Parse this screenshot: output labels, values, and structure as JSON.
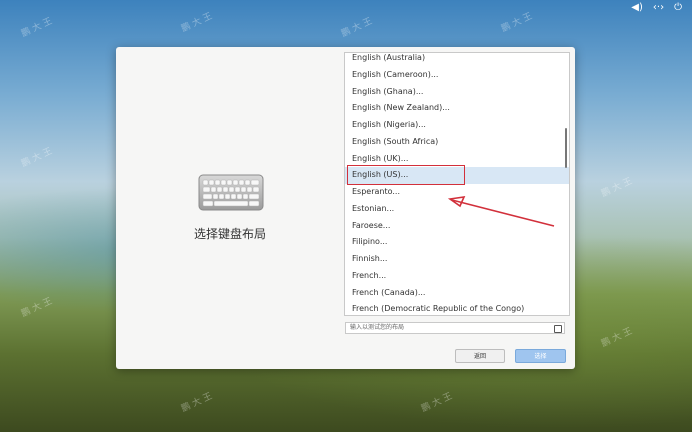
{
  "topbar": {
    "volume_icon": "speaker-icon",
    "network_icon": "network-icon",
    "power_icon": "power-icon"
  },
  "dialog": {
    "title": "选择键盘布局",
    "layouts": [
      "English (Australia)",
      "English (Cameroon)...",
      "English (Ghana)...",
      "English (New Zealand)...",
      "English (Nigeria)...",
      "English (South Africa)",
      "English (UK)...",
      "English (US)...",
      "Esperanto...",
      "Estonian...",
      "Faroese...",
      "Filipino...",
      "Finnish...",
      "French...",
      "French (Canada)...",
      "French (Democratic Republic of the Congo)"
    ],
    "selected_index": 7,
    "search_placeholder": "输入以测试您的布局",
    "back_label": "返回",
    "next_label": "选择"
  },
  "watermark_text": "鹏 大 王",
  "colors": {
    "selection": "#d8e7f5",
    "annotation": "#d2303b",
    "primary_button": "#9fc5ef"
  }
}
